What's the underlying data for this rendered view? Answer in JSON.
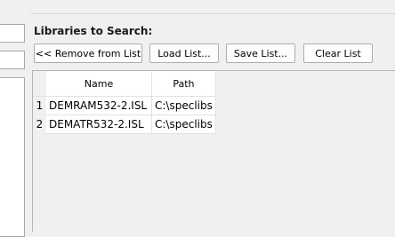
{
  "panel": {
    "title": "Libraries to Search:",
    "buttons": {
      "remove": "<< Remove from  List",
      "load": "Load List...",
      "save": "Save List...",
      "clear": "Clear List"
    }
  },
  "table": {
    "columns": [
      "Name",
      "Path"
    ],
    "rows": [
      {
        "num": "1",
        "name": "DEMRAM532-2.ISL",
        "path": "C:\\speclibs"
      },
      {
        "num": "2",
        "name": "DEMATR532-2.ISL",
        "path": "C:\\speclibs"
      }
    ]
  }
}
